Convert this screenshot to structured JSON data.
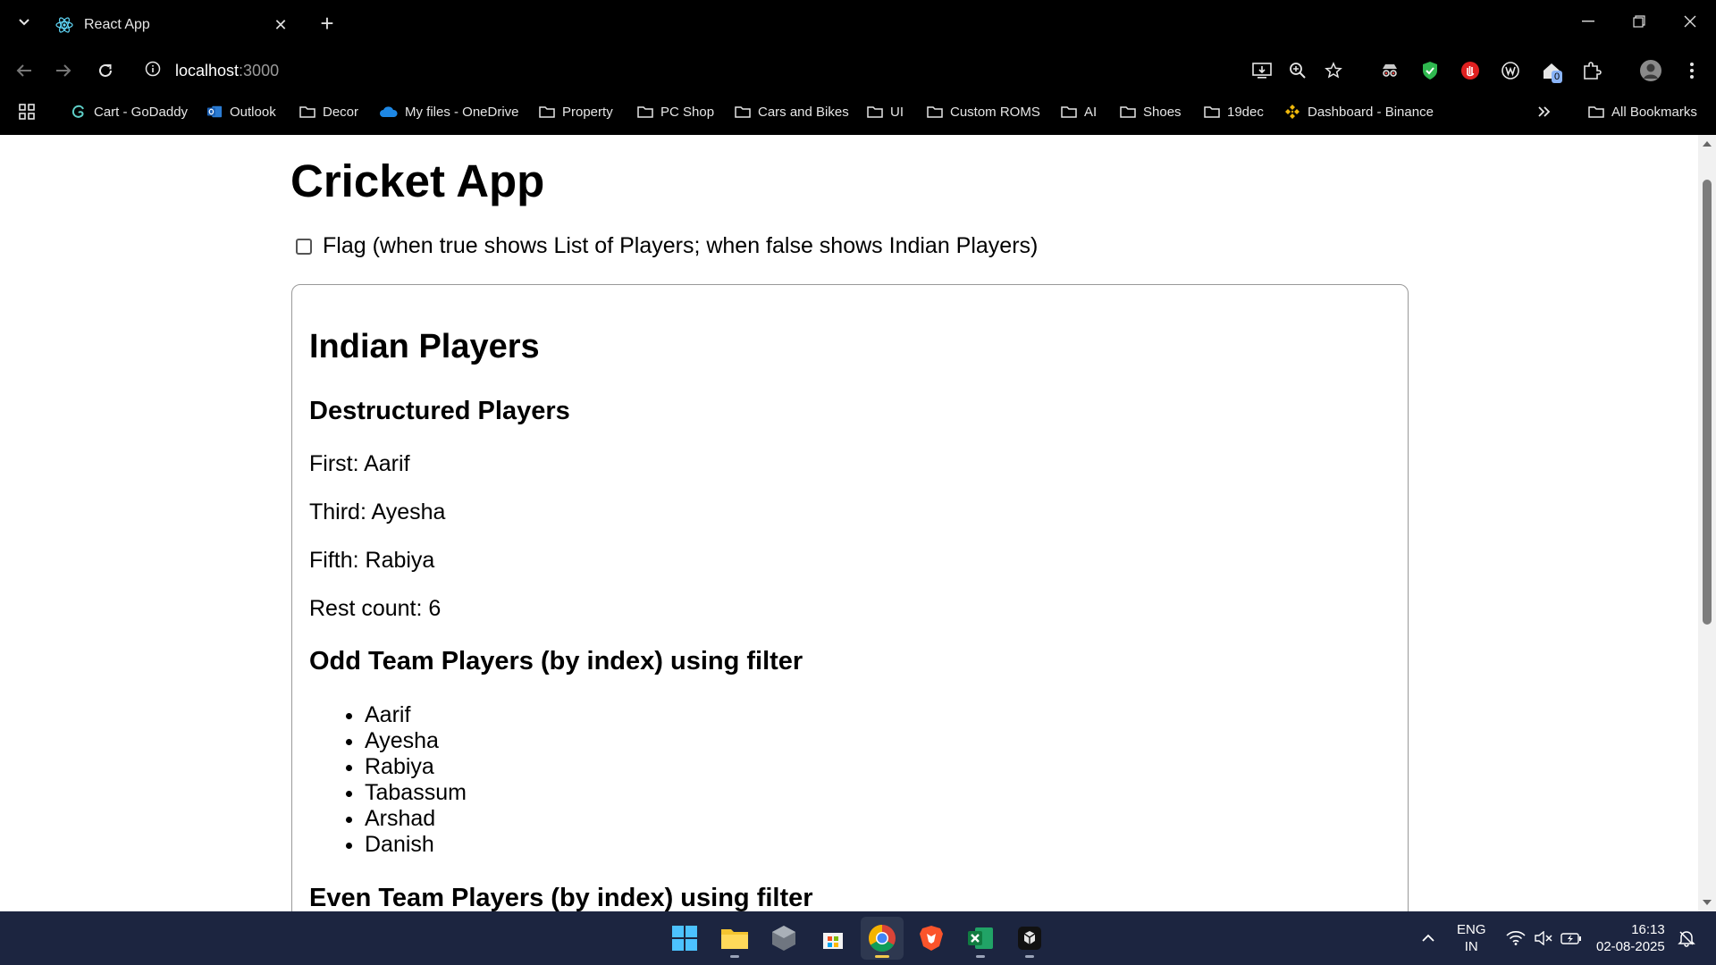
{
  "browser": {
    "tab_title": "React App",
    "url_host": "localhost",
    "url_port": ":3000",
    "bookmarks": [
      {
        "label": "Cart - GoDaddy",
        "icon": "godaddy-icon"
      },
      {
        "label": "Outlook",
        "icon": "outlook-icon"
      },
      {
        "label": "Decor",
        "icon": "folder-icon"
      },
      {
        "label": "My files - OneDrive",
        "icon": "onedrive-icon"
      },
      {
        "label": "Property",
        "icon": "folder-icon"
      },
      {
        "label": "PC Shop",
        "icon": "folder-icon"
      },
      {
        "label": "Cars and Bikes",
        "icon": "folder-icon"
      },
      {
        "label": "UI",
        "icon": "folder-icon"
      },
      {
        "label": "Custom ROMS",
        "icon": "folder-icon"
      },
      {
        "label": "AI",
        "icon": "folder-icon"
      },
      {
        "label": "Shoes",
        "icon": "folder-icon"
      },
      {
        "label": "19dec",
        "icon": "folder-icon"
      },
      {
        "label": "Dashboard - Binance",
        "icon": "binance-icon"
      }
    ],
    "all_bookmarks": "All Bookmarks",
    "extension_badge": "0"
  },
  "page": {
    "title": "Cricket App",
    "flag_label": "Flag (when true shows List of Players; when false shows Indian Players)",
    "flag_checked": false,
    "card": {
      "heading": "Indian Players",
      "destructured_heading": "Destructured Players",
      "first": "First: Aarif",
      "third": "Third: Ayesha",
      "fifth": "Fifth: Rabiya",
      "rest": "Rest count: 6",
      "odd_heading": "Odd Team Players (by index) using filter",
      "odd_players": [
        "Aarif",
        "Ayesha",
        "Rabiya",
        "Tabassum",
        "Arshad",
        "Danish"
      ],
      "even_heading": "Even Team Players (by index) using filter"
    }
  },
  "taskbar": {
    "lang": "ENG",
    "region": "IN",
    "time": "16:13",
    "date": "02-08-2025"
  }
}
